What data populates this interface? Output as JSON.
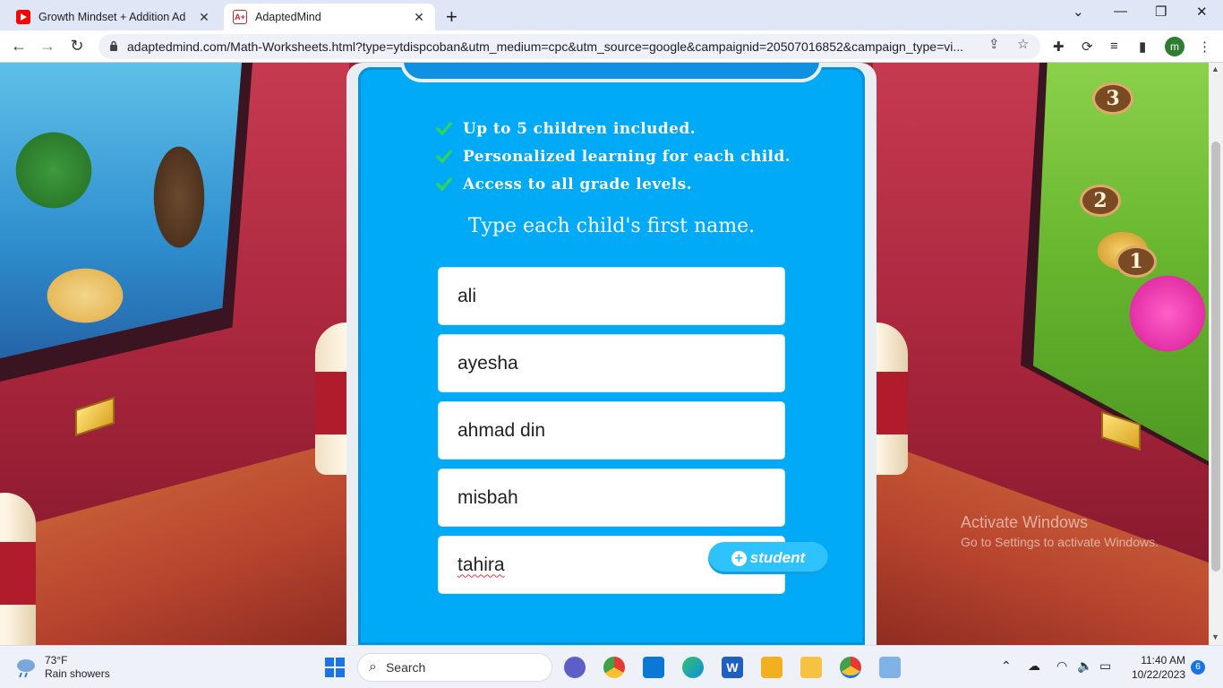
{
  "browser": {
    "tabs": [
      {
        "title": "Growth Mindset + Addition Ad",
        "icon": "youtube-icon",
        "active": false
      },
      {
        "title": "AdaptedMind",
        "icon": "adaptedmind-icon",
        "active": true
      }
    ],
    "url": "adaptedmind.com/Math-Worksheets.html?type=ytdispcoban&utm_medium=cpc&utm_source=google&campaignid=20507016852&campaign_type=vi...",
    "profile_initial": "m"
  },
  "signup": {
    "features": [
      "Up to 5 children included.",
      "Personalized learning for each child.",
      "Access to all grade levels."
    ],
    "prompt": "Type each child's first name.",
    "children": [
      "ali",
      "ayesha",
      "ahmad din",
      "misbah",
      "tahira"
    ],
    "add_button_label": "student"
  },
  "scene": {
    "map_numbers_right": [
      "3",
      "2",
      "1"
    ]
  },
  "watermark": {
    "line1": "Activate Windows",
    "line2": "Go to Settings to activate Windows."
  },
  "taskbar": {
    "weather_temp": "73°F",
    "weather_desc": "Rain showers",
    "search_label": "Search",
    "time": "11:40 AM",
    "date": "10/22/2023",
    "notification_count": "6"
  },
  "colors": {
    "panel_blue": "#00aaf6",
    "check_green": "#2fd25a",
    "wall_red": "#a5243a"
  }
}
